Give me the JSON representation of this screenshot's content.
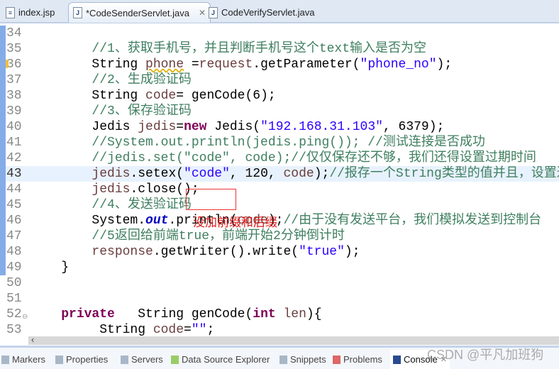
{
  "tabs": [
    {
      "label": "index.jsp",
      "icon": "jsp-file-icon"
    },
    {
      "label": "*CodeSenderServlet.java",
      "icon": "java-file-icon",
      "active": true
    },
    {
      "label": "CodeVerifyServlet.java",
      "icon": "java-file-icon"
    }
  ],
  "lines": [
    {
      "n": "34",
      "html": ""
    },
    {
      "n": "35",
      "html": "        <span class='c'>//1、获取手机号，并且判断手机号这个text输入是否为空</span>"
    },
    {
      "n": "36",
      "html": "        String <span class='v squig'>phone</span> =<span class='v'>request</span>.getParameter(<span class='s'>\"phone_no\"</span>);",
      "warn": true
    },
    {
      "n": "37",
      "html": "        <span class='c'>//2、生成验证码</span>"
    },
    {
      "n": "38",
      "html": "        String <span class='v'>code</span>= genCode(6);"
    },
    {
      "n": "39",
      "html": "        <span class='c'>//3、保存验证码</span>"
    },
    {
      "n": "40",
      "html": "        Jedis <span class='v'>jedis</span>=<span class='k'>new</span> Jedis(<span class='s'>\"192.168.31.103\"</span>, 6379);"
    },
    {
      "n": "41",
      "html": "        <span class='c'>//System.out.println(jedis.ping()); //测试连接是否成功</span>"
    },
    {
      "n": "42",
      "html": "        <span class='c'>//jedis.set(\"code\", code);//仅仅保存还不够，我们还得设置过期时间</span>"
    },
    {
      "n": "43",
      "html": "        <span class='v'>jedis</span>.setex(<span class='s'>\"code\"</span>, 120, <span class='v'>code</span>);<span class='c'>//报存一个String类型的值并且，设置过期时间</span>",
      "cur": true
    },
    {
      "n": "44",
      "html": "        <span class='v'>jedis</span>.close();"
    },
    {
      "n": "45",
      "html": "        <span class='c'>//4、发送验证码</span>"
    },
    {
      "n": "46",
      "html": "        System.<span class='f'>out</span>.println(<span class='v'>code</span>);<span class='c'>//由于没有发送平台，我们模拟发送到控制台</span>"
    },
    {
      "n": "47",
      "html": "        <span class='c'>//5返回给前端true，前端开始2分钟倒计时</span>"
    },
    {
      "n": "48",
      "html": "        <span class='v'>response</span>.getWriter().write(<span class='s'>\"true\"</span>);"
    },
    {
      "n": "49",
      "html": "    }"
    },
    {
      "n": "50",
      "html": ""
    },
    {
      "n": "51",
      "html": ""
    },
    {
      "n": "52",
      "html": "    <span class='k'>private</span>   String genCode(<span class='k'>int</span> <span class='v'>len</span>){",
      "fold": true
    },
    {
      "n": "53",
      "html": "         String <span class='v'>code</span>=<span class='s'>\"\"</span>;"
    }
  ],
  "annotation": "没加前缀和后缀",
  "bottom_tabs": [
    {
      "label": "Markers"
    },
    {
      "label": "Properties"
    },
    {
      "label": "Servers"
    },
    {
      "label": "Data Source Explorer"
    },
    {
      "label": "Snippets"
    },
    {
      "label": "Problems"
    },
    {
      "label": "Console",
      "active": true
    }
  ],
  "watermark": "CSDN @平凡加班狗",
  "colors": {
    "keyword": "#7f0055",
    "string": "#2a00ff",
    "comment": "#3f7f5f",
    "variable": "#6a3e3e",
    "annotation": "#e02020"
  }
}
